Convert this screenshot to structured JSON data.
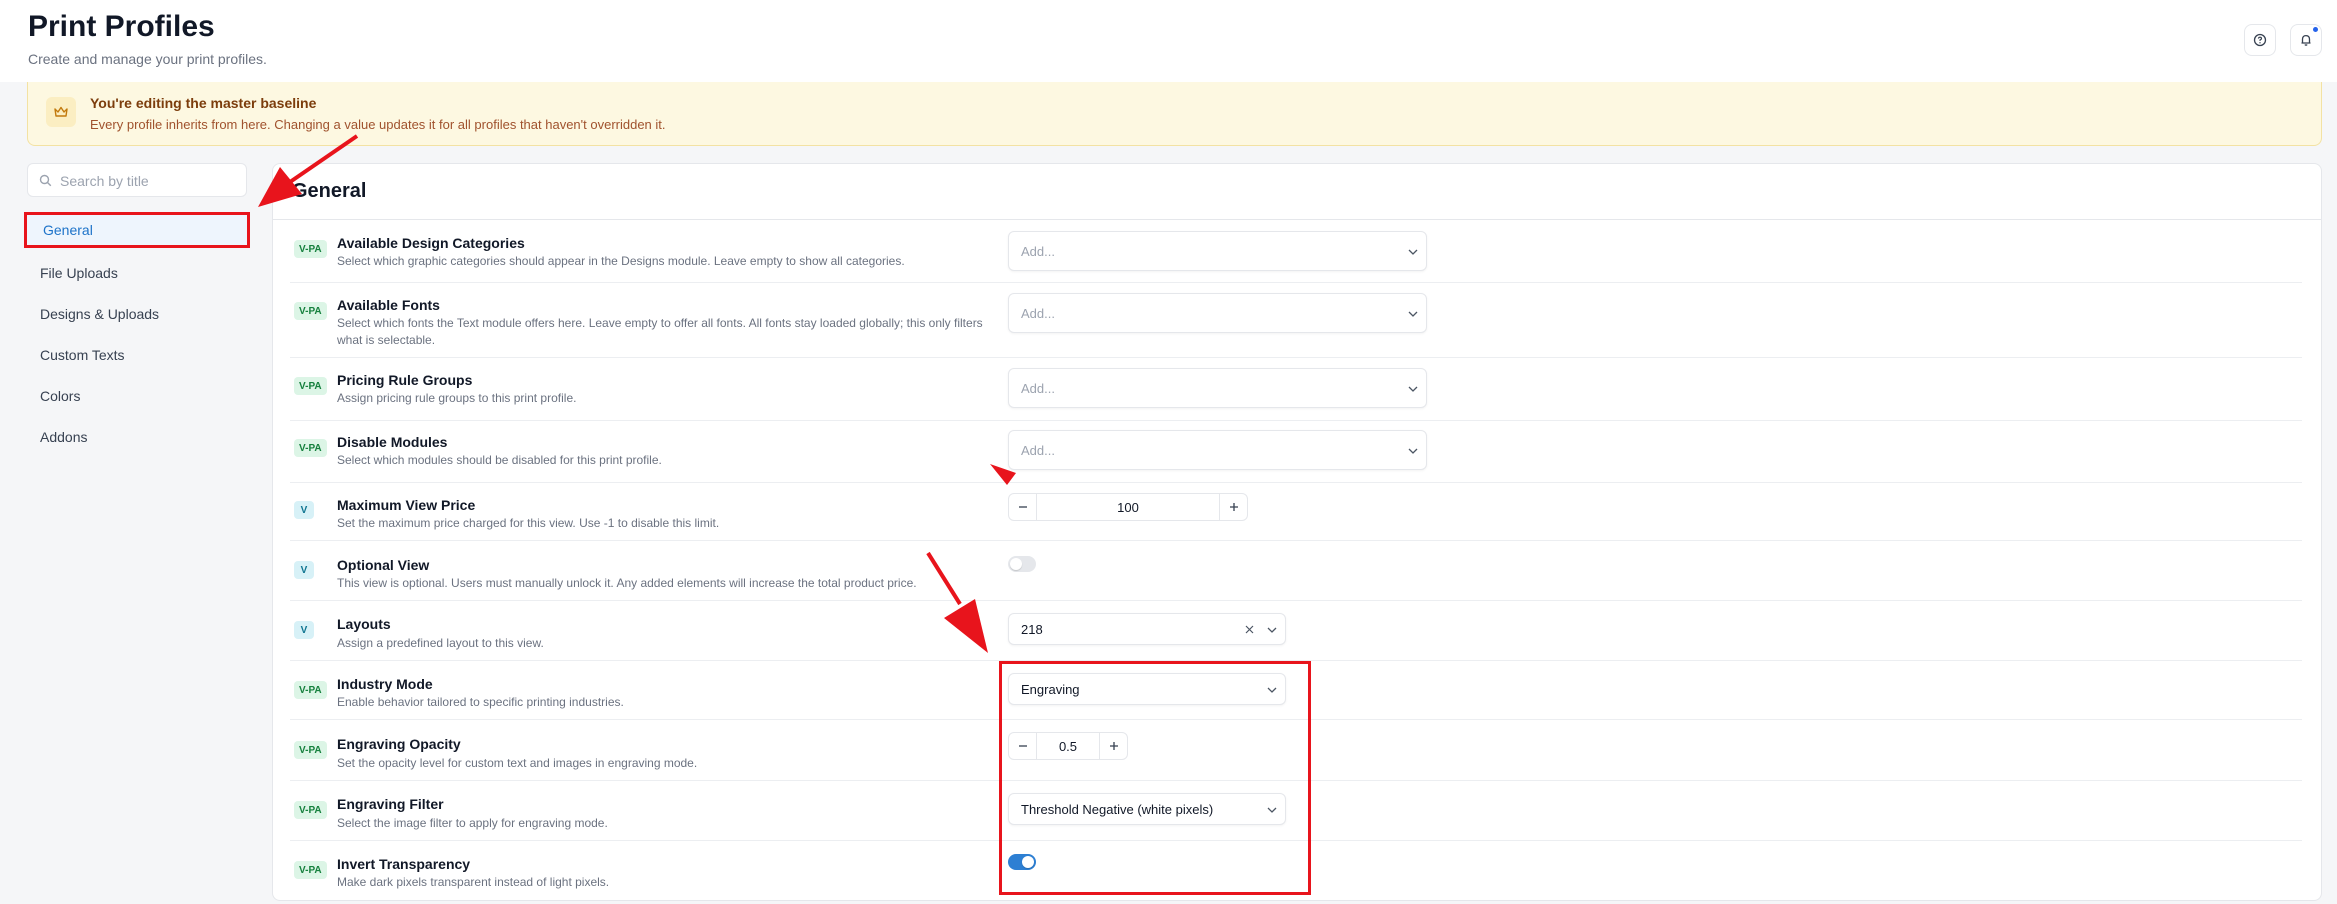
{
  "header": {
    "title": "Print Profiles",
    "subtitle": "Create and manage your print profiles."
  },
  "banner": {
    "title": "You're editing the master baseline",
    "text": "Every profile inherits from here. Changing a value updates it for all profiles that haven't overridden it."
  },
  "sidebar": {
    "search_placeholder": "Search by title",
    "items": [
      {
        "label": "General",
        "active": true
      },
      {
        "label": "File Uploads"
      },
      {
        "label": "Designs & Uploads"
      },
      {
        "label": "Custom Texts"
      },
      {
        "label": "Colors"
      },
      {
        "label": "Addons"
      }
    ]
  },
  "main": {
    "section_title": "General",
    "settings": [
      {
        "badge": "V-PA",
        "label": "Available Design Categories",
        "desc": "Select which graphic categories should appear in the Designs module. Leave empty to show all categories.",
        "control": "multiselect",
        "placeholder": "Add..."
      },
      {
        "badge": "V-PA",
        "label": "Available Fonts",
        "desc": "Select which fonts the Text module offers here. Leave empty to offer all fonts. All fonts stay loaded globally; this only filters what is selectable.",
        "control": "multiselect",
        "placeholder": "Add..."
      },
      {
        "badge": "V-PA",
        "label": "Pricing Rule Groups",
        "desc": "Assign pricing rule groups to this print profile.",
        "control": "multiselect",
        "placeholder": "Add..."
      },
      {
        "badge": "V-PA",
        "label": "Disable Modules",
        "desc": "Select which modules should be disabled for this print profile.",
        "control": "multiselect",
        "placeholder": "Add..."
      },
      {
        "badge": "V",
        "label": "Maximum View Price",
        "desc": "Set the maximum price charged for this view. Use -1 to disable this limit.",
        "control": "stepper",
        "value": "100"
      },
      {
        "badge": "V",
        "label": "Optional View",
        "desc": "This view is optional. Users must manually unlock it. Any added elements will increase the total product price.",
        "control": "toggle",
        "on": false
      },
      {
        "badge": "V",
        "label": "Layouts",
        "desc": "Assign a predefined layout to this view.",
        "control": "select-clearable",
        "value": "218"
      },
      {
        "badge": "V-PA",
        "label": "Industry Mode",
        "desc": "Enable behavior tailored to specific printing industries.",
        "control": "select",
        "value": "Engraving"
      },
      {
        "badge": "V-PA",
        "label": "Engraving Opacity",
        "desc": "Set the opacity level for custom text and images in engraving mode.",
        "control": "stepper",
        "value": "0.5"
      },
      {
        "badge": "V-PA",
        "label": "Engraving Filter",
        "desc": "Select the image filter to apply for engraving mode.",
        "control": "select",
        "value": "Threshold Negative (white pixels)"
      },
      {
        "badge": "V-PA",
        "label": "Invert Transparency",
        "desc": "Make dark pixels transparent instead of light pixels.",
        "control": "toggle",
        "on": true
      }
    ]
  },
  "icons": {
    "search": "search-icon",
    "help": "help-circle-icon",
    "bell": "bell-icon",
    "crown": "crown-icon",
    "chevron": "chevron-down-icon",
    "clear": "close-icon",
    "minus": "minus-icon",
    "plus": "plus-icon"
  },
  "colors": {
    "accent": "#2d7fd3",
    "annotation": "#e8141c",
    "banner_bg": "#fdf8e1"
  }
}
